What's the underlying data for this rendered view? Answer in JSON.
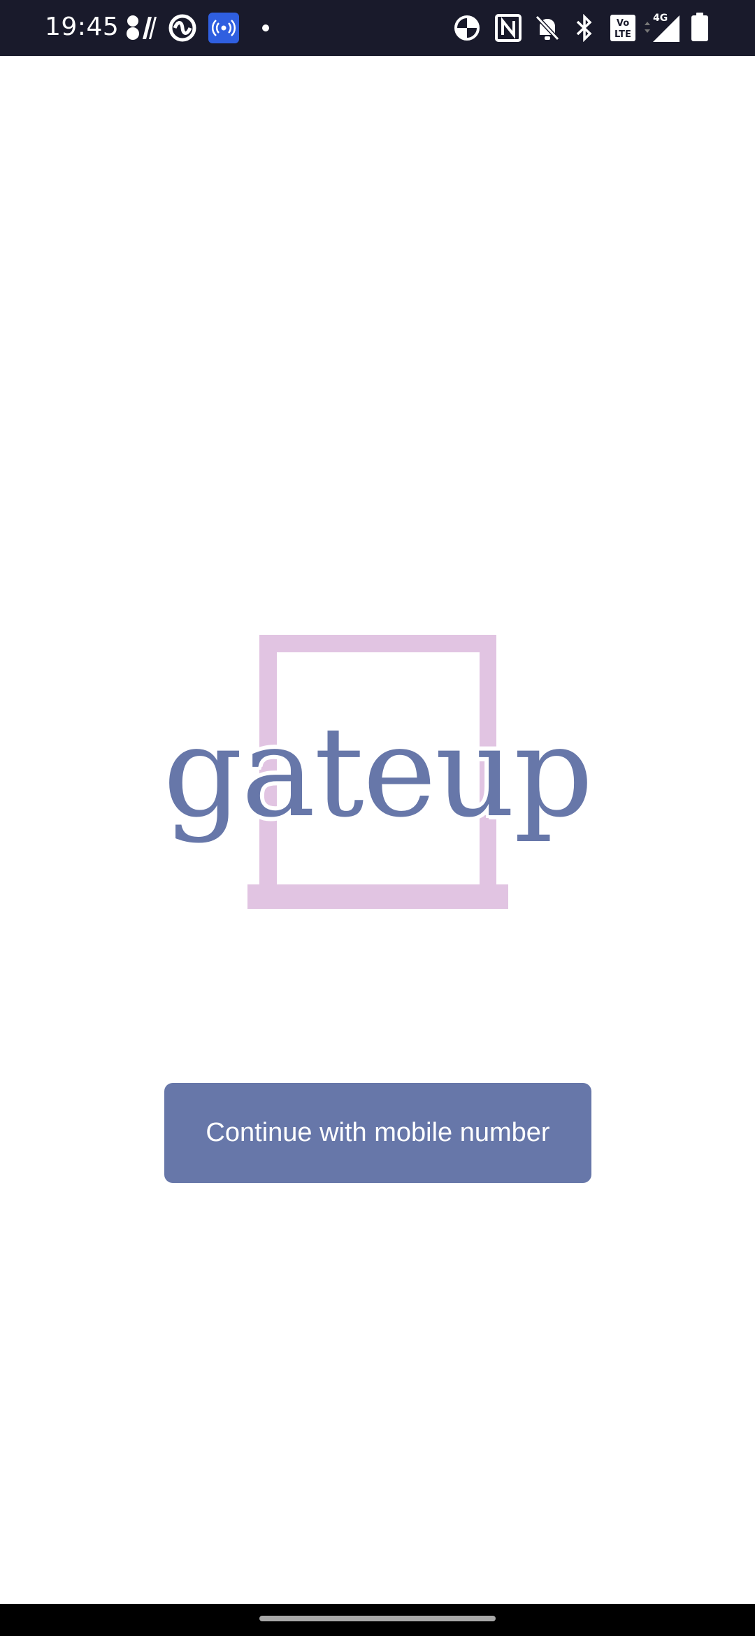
{
  "status_bar": {
    "time": "19:45",
    "icons": [
      "wechat-icon",
      "compass-icon",
      "hotspot-icon",
      "dot-icon",
      "data-saver-icon",
      "nfc-icon",
      "bell-off-icon",
      "bluetooth-icon",
      "volte-icon",
      "signal-icon",
      "battery-icon"
    ],
    "network_label": "4G",
    "volte_label": "Vo LTE",
    "background": "#191a2b"
  },
  "logo": {
    "text": "gateup",
    "text_color": "#6777a9",
    "frame_color": "#e1c4e2"
  },
  "actions": {
    "continue_label": "Continue with mobile number",
    "button_color": "#6777a9"
  }
}
